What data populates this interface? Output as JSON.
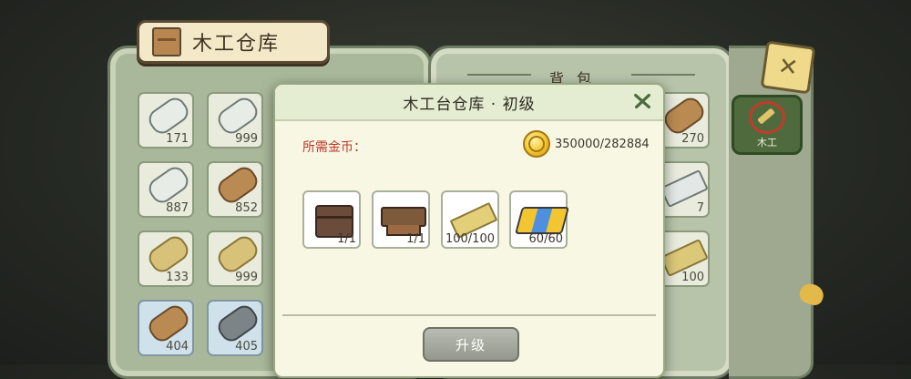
{
  "warehouse": {
    "title": "木工仓库"
  },
  "left_grid": [
    {
      "count": "171",
      "type": "birch"
    },
    {
      "count": "999",
      "type": "birch"
    },
    {
      "count": "887",
      "type": "birch"
    },
    {
      "count": "852",
      "type": "wood"
    },
    {
      "count": "133",
      "type": "light"
    },
    {
      "count": "999",
      "type": "light"
    },
    {
      "count": "404",
      "type": "wood"
    },
    {
      "count": "405",
      "type": "dark"
    }
  ],
  "bag": {
    "title": "背包",
    "items": [
      {
        "count": "270",
        "type": "wood"
      },
      {
        "count": "7",
        "type": "birch"
      },
      {
        "count": "100",
        "type": "light"
      }
    ]
  },
  "side_tab": {
    "label": "木工"
  },
  "modal": {
    "title": "木工台仓库 · 初级",
    "gold_label": "所需金币：",
    "gold_amount": "350000/282884",
    "requirements": [
      {
        "icon": "chest-icon",
        "count": "1/1"
      },
      {
        "icon": "workbench-icon",
        "count": "1/1"
      },
      {
        "icon": "plank-icon",
        "count": "100/100"
      },
      {
        "icon": "ingot-icon",
        "count": "60/60"
      }
    ],
    "upgrade_label": "升级"
  }
}
